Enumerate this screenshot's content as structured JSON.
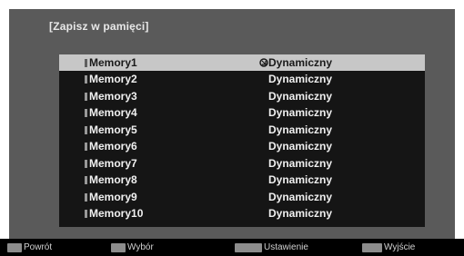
{
  "title": "[Zapisz w pamięci]",
  "rows": [
    {
      "name": "Memory1",
      "value": "Dynamiczny"
    },
    {
      "name": "Memory2",
      "value": "Dynamiczny"
    },
    {
      "name": "Memory3",
      "value": "Dynamiczny"
    },
    {
      "name": "Memory4",
      "value": "Dynamiczny"
    },
    {
      "name": "Memory5",
      "value": "Dynamiczny"
    },
    {
      "name": "Memory6",
      "value": "Dynamiczny"
    },
    {
      "name": "Memory7",
      "value": "Dynamiczny"
    },
    {
      "name": "Memory8",
      "value": "Dynamiczny"
    },
    {
      "name": "Memory9",
      "value": "Dynamiczny"
    },
    {
      "name": "Memory10",
      "value": "Dynamiczny"
    }
  ],
  "footer": {
    "back": "Powrót",
    "select": "Wybór",
    "set": "Ustawienie",
    "exit": "Wyjście"
  },
  "colors": {
    "panel": "#5a5a5a",
    "list_bg": "#151515",
    "selected_row": "#c7c7c7"
  },
  "icons": {
    "cursor": "pointer-cursor-icon"
  }
}
